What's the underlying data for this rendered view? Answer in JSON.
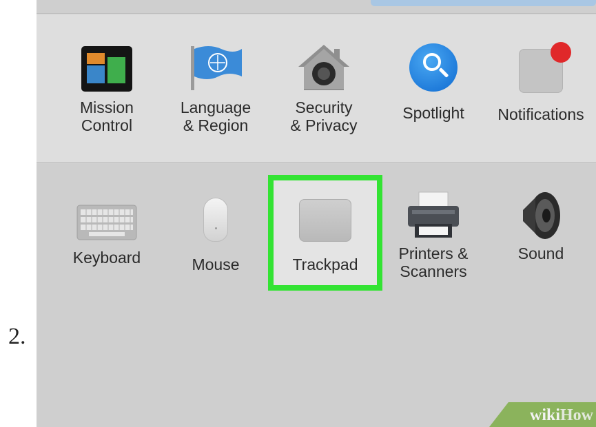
{
  "step": {
    "number": "2."
  },
  "row1": [
    {
      "id": "mission-control",
      "label": "Mission\nControl",
      "icon": "mission-control-icon"
    },
    {
      "id": "language-region",
      "label": "Language\n& Region",
      "icon": "un-flag-icon"
    },
    {
      "id": "security-privacy",
      "label": "Security\n& Privacy",
      "icon": "house-lock-icon"
    },
    {
      "id": "spotlight",
      "label": "Spotlight",
      "icon": "magnifier-icon"
    },
    {
      "id": "notifications",
      "label": "Notifications",
      "icon": "notification-badge-icon"
    }
  ],
  "row2": [
    {
      "id": "keyboard",
      "label": "Keyboard",
      "icon": "keyboard-icon"
    },
    {
      "id": "mouse",
      "label": "Mouse",
      "icon": "mouse-icon"
    },
    {
      "id": "trackpad",
      "label": "Trackpad",
      "icon": "trackpad-icon"
    },
    {
      "id": "printers-scanners",
      "label": "Printers &\nScanners",
      "icon": "printer-icon"
    },
    {
      "id": "sound",
      "label": "Sound",
      "icon": "speaker-icon"
    }
  ],
  "watermark": {
    "part1": "wiki",
    "part2": "How"
  },
  "colors": {
    "highlight": "#33e333",
    "panel": "#d6d6d6",
    "notification_badge": "#e0282a"
  }
}
